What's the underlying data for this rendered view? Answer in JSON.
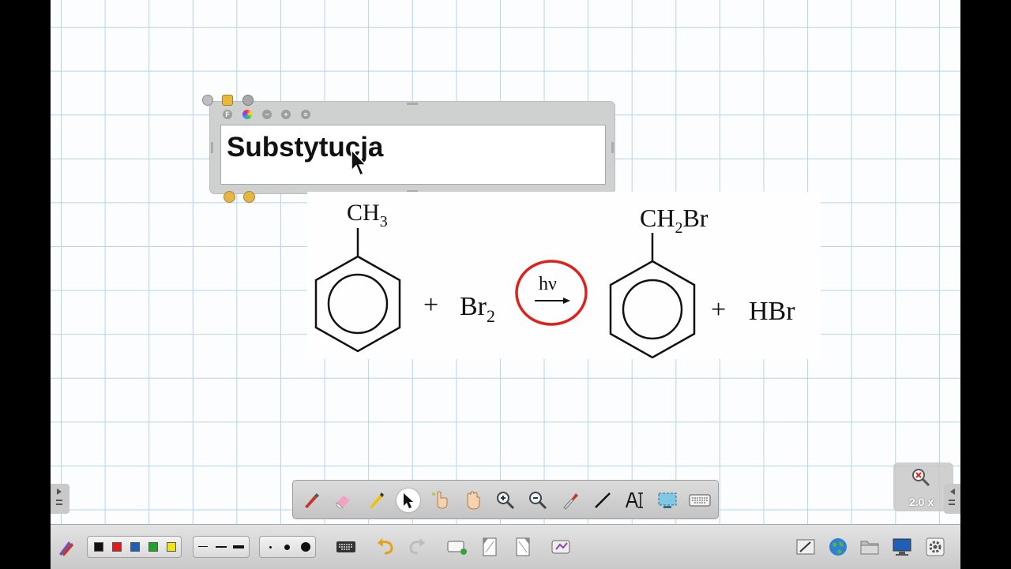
{
  "textbox": {
    "title": "Substytucja"
  },
  "equation": {
    "reactant_top": "CH",
    "reactant_sub": "3",
    "plus1": "+",
    "reagent": "Br",
    "reagent_sub": "2",
    "condition": "hν",
    "product_top_a": "CH",
    "product_top_sub": "2",
    "product_top_b": "Br",
    "plus2": "+",
    "byproduct": "HBr"
  },
  "zoom": {
    "level": "2.0 x"
  },
  "colors": {
    "swatches": [
      "#111111",
      "#e21a1a",
      "#1f5fb7",
      "#1fa32a",
      "#f1e21b"
    ],
    "highlight_ring": "#e0201a",
    "grid": "#b7d3ea"
  },
  "tools": [
    "pen-icon",
    "eraser-icon",
    "highlighter-icon",
    "pointer-icon",
    "select-hand-icon",
    "pan-hand-icon",
    "zoom-in-icon",
    "zoom-out-icon",
    "pipette-icon",
    "line-icon",
    "text-icon",
    "screen-capture-icon",
    "keyboard-icon"
  ]
}
